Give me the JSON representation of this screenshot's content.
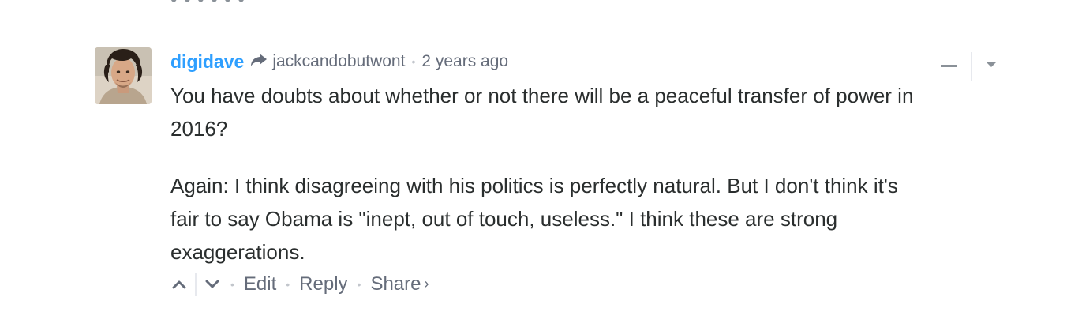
{
  "comment": {
    "author": "digidave",
    "parent_author": "jackcandobutwont",
    "separator": "•",
    "timestamp": "2 years ago",
    "paragraphs": [
      "You have doubts about whether or not there will be a peaceful transfer of power in 2016?",
      "Again: I think disagreeing with his politics is perfectly natural. But I don't think it's fair to say Obama is \"inept, out of touch, useless.\" I think these are strong exaggerations."
    ],
    "footer": {
      "edit_label": "Edit",
      "reply_label": "Reply",
      "share_label": "Share",
      "share_chevron": "›"
    }
  },
  "icons": {
    "reply_arrow": "reply-arrow-icon",
    "collapse": "collapse-icon",
    "menu": "chevron-down-icon",
    "upvote": "upvote-icon",
    "downvote": "downvote-icon"
  },
  "colors": {
    "author": "#2e9fff",
    "meta_text": "#656c7a",
    "body_text": "#2a2e2e",
    "separator": "#e7e9ee"
  }
}
